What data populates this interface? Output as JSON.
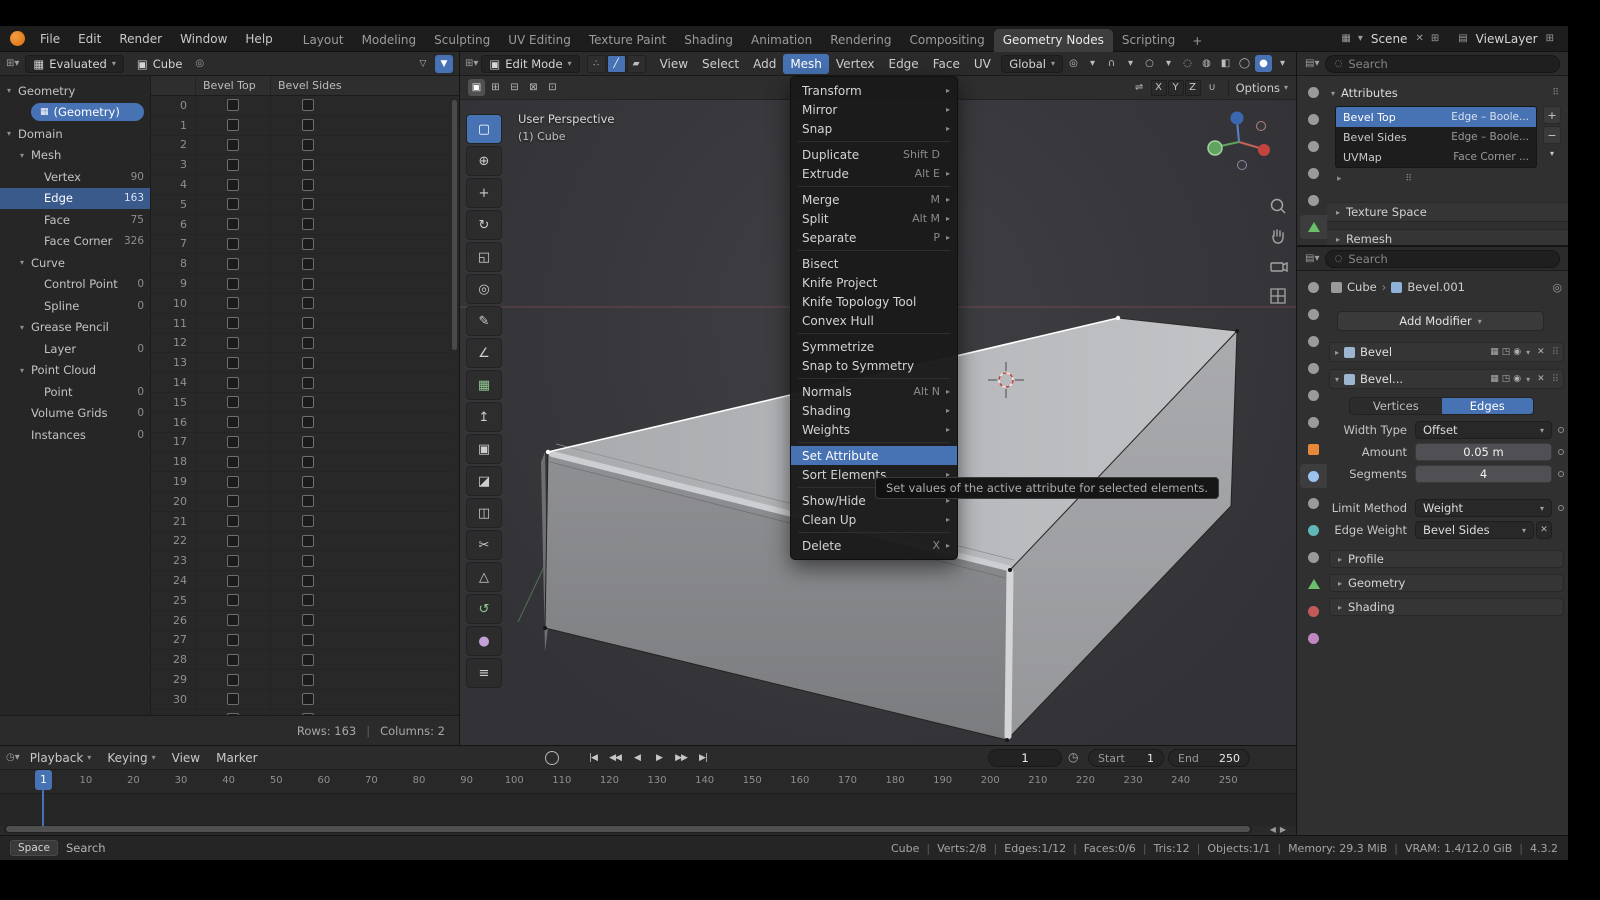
{
  "topbar": {
    "menus": [
      "File",
      "Edit",
      "Render",
      "Window",
      "Help"
    ],
    "workspaces": [
      "Layout",
      "Modeling",
      "Sculpting",
      "UV Editing",
      "Texture Paint",
      "Shading",
      "Animation",
      "Rendering",
      "Compositing",
      "Geometry Nodes",
      "Scripting"
    ],
    "active_workspace": "Geometry Nodes",
    "add_workspace": "+",
    "scene": "Scene",
    "view_layer": "ViewLayer"
  },
  "spreadsheet": {
    "dataset": "Evaluated",
    "object": "Cube",
    "tree": [
      {
        "label": "Geometry",
        "kind": "branch",
        "indent": 0
      },
      {
        "label": "(Geometry)",
        "kind": "pill",
        "indent": 1
      },
      {
        "label": "Domain",
        "kind": "branch",
        "indent": 0
      },
      {
        "label": "Mesh",
        "kind": "branch",
        "indent": 1
      },
      {
        "label": "Vertex",
        "count": "90",
        "kind": "leaf",
        "indent": 2
      },
      {
        "label": "Edge",
        "count": "163",
        "kind": "leaf",
        "indent": 2,
        "active": true
      },
      {
        "label": "Face",
        "count": "75",
        "kind": "leaf",
        "indent": 2
      },
      {
        "label": "Face Corner",
        "count": "326",
        "kind": "leaf",
        "indent": 2
      },
      {
        "label": "Curve",
        "kind": "branch",
        "indent": 1
      },
      {
        "label": "Control Point",
        "count": "0",
        "kind": "leaf",
        "indent": 2
      },
      {
        "label": "Spline",
        "count": "0",
        "kind": "leaf",
        "indent": 2
      },
      {
        "label": "Grease Pencil",
        "kind": "branch",
        "indent": 1
      },
      {
        "label": "Layer",
        "count": "0",
        "kind": "leaf",
        "indent": 2
      },
      {
        "label": "Point Cloud",
        "kind": "branch",
        "indent": 1
      },
      {
        "label": "Point",
        "count": "0",
        "kind": "leaf",
        "indent": 2
      },
      {
        "label": "Volume Grids",
        "count": "0",
        "kind": "leaf",
        "indent": 1
      },
      {
        "label": "Instances",
        "count": "0",
        "kind": "leaf",
        "indent": 1
      }
    ],
    "columns": [
      "Bevel Top",
      "Bevel Sides"
    ],
    "rows_visible_start": 0,
    "rows_visible_count": 32,
    "footer_rows": "Rows: 163",
    "footer_columns": "Columns: 2"
  },
  "viewport": {
    "mode": "Edit Mode",
    "menus": [
      "View",
      "Select",
      "Add",
      "Mesh",
      "Vertex",
      "Edge",
      "Face",
      "UV"
    ],
    "active_menu": "Mesh",
    "orientation": "Global",
    "options_label": "Options",
    "mirror_axes": [
      "X",
      "Y",
      "Z"
    ],
    "overlay_title": "User Perspective",
    "overlay_subtitle": "(1) Cube",
    "select_modes": [
      {
        "name": "vertex-select-mode",
        "glyph": "∴"
      },
      {
        "name": "edge-select-mode",
        "glyph": "╱",
        "active": true
      },
      {
        "name": "face-select-mode",
        "glyph": "▰"
      }
    ],
    "select_options": [
      {
        "name": "select-set",
        "glyph": "▣",
        "active": true
      },
      {
        "name": "select-extend",
        "glyph": "⊞"
      },
      {
        "name": "select-subtract",
        "glyph": "⊟"
      },
      {
        "name": "select-difference",
        "glyph": "⊠"
      },
      {
        "name": "select-intersect",
        "glyph": "⊡"
      }
    ],
    "header_icons": [
      {
        "name": "transform-pivot",
        "glyph": "◎"
      },
      {
        "name": "pivot-dropdown",
        "glyph": "▾"
      },
      {
        "name": "snap-magnet",
        "glyph": "∩"
      },
      {
        "name": "snap-dropdown",
        "glyph": "▾"
      },
      {
        "name": "proportional-editing",
        "glyph": "○"
      },
      {
        "name": "proportional-dropdown",
        "glyph": "▾"
      },
      {
        "name": "show-gizmo",
        "glyph": "◌"
      },
      {
        "name": "show-overlays",
        "glyph": "◍"
      },
      {
        "name": "toggle-xray",
        "glyph": "◧"
      },
      {
        "name": "shading-wireframe",
        "glyph": "◯"
      },
      {
        "name": "shading-solid",
        "glyph": "●",
        "active": true
      },
      {
        "name": "shading-dropdown",
        "glyph": "▾"
      }
    ]
  },
  "toolbar": {
    "tools": [
      {
        "name": "box-select",
        "glyph": "▢",
        "active": true
      },
      {
        "name": "cursor",
        "glyph": "⊕"
      },
      {
        "name": "move",
        "glyph": "+"
      },
      {
        "name": "rotate",
        "glyph": "↻"
      },
      {
        "name": "scale",
        "glyph": "◱"
      },
      {
        "name": "transform",
        "glyph": "◎"
      },
      {
        "name": "annotate",
        "glyph": "✎"
      },
      {
        "name": "measure",
        "glyph": "∠"
      },
      {
        "name": "add-cube",
        "glyph": "▦",
        "tint": "#8fc98f"
      },
      {
        "name": "extrude-region",
        "glyph": "↥"
      },
      {
        "name": "inset-faces",
        "glyph": "▣"
      },
      {
        "name": "bevel",
        "glyph": "◪"
      },
      {
        "name": "loop-cut",
        "glyph": "◫"
      },
      {
        "name": "knife",
        "glyph": "✂"
      },
      {
        "name": "poly-build",
        "glyph": "△"
      },
      {
        "name": "spin",
        "glyph": "↺",
        "tint": "#8fc98f"
      },
      {
        "name": "smooth",
        "glyph": "●",
        "tint": "#c2a0d8"
      },
      {
        "name": "edge-slide",
        "glyph": "≡"
      }
    ]
  },
  "mesh_menu": {
    "groups": [
      [
        {
          "label": "Transform",
          "sub": true
        },
        {
          "label": "Mirror",
          "sub": true
        },
        {
          "label": "Snap",
          "sub": true
        }
      ],
      [
        {
          "label": "Duplicate",
          "key": "Shift D"
        },
        {
          "label": "Extrude",
          "key": "Alt E",
          "sub": true
        }
      ],
      [
        {
          "label": "Merge",
          "key": "M",
          "sub": true
        },
        {
          "label": "Split",
          "key": "Alt M",
          "sub": true
        },
        {
          "label": "Separate",
          "key": "P",
          "sub": true
        }
      ],
      [
        {
          "label": "Bisect"
        },
        {
          "label": "Knife Project"
        },
        {
          "label": "Knife Topology Tool"
        },
        {
          "label": "Convex Hull"
        }
      ],
      [
        {
          "label": "Symmetrize"
        },
        {
          "label": "Snap to Symmetry"
        }
      ],
      [
        {
          "label": "Normals",
          "key": "Alt N",
          "sub": true
        },
        {
          "label": "Shading",
          "sub": true
        },
        {
          "label": "Weights",
          "sub": true
        }
      ],
      [
        {
          "label": "Set Attribute",
          "active": true
        },
        {
          "label": "Sort Elements",
          "sub": true
        }
      ],
      [
        {
          "label": "Show/Hide",
          "sub": true
        },
        {
          "label": "Clean Up",
          "sub": true
        }
      ],
      [
        {
          "label": "Delete",
          "key": "X",
          "sub": true
        }
      ]
    ]
  },
  "tooltip": {
    "text": "Set values of the active attribute for selected elements."
  },
  "prop_tabs_top": [
    {
      "name": "tool"
    },
    {
      "name": "render"
    },
    {
      "name": "output"
    },
    {
      "name": "view-layer"
    },
    {
      "name": "scene"
    },
    {
      "name": "object-data",
      "shape": "triangle",
      "color": "#6cc06c",
      "active": true
    }
  ],
  "prop_tabs_bottom": [
    {
      "name": "tool"
    },
    {
      "name": "render"
    },
    {
      "name": "output"
    },
    {
      "name": "view-layer"
    },
    {
      "name": "scene"
    },
    {
      "name": "world"
    },
    {
      "name": "object",
      "shape": "square",
      "color": "#e8883a"
    },
    {
      "name": "modifiers",
      "color": "#9cc3ee",
      "active": true
    },
    {
      "name": "particles"
    },
    {
      "name": "physics",
      "color": "#5fb7b7"
    },
    {
      "name": "constraints"
    },
    {
      "name": "object-data",
      "shape": "triangle",
      "color": "#6cc06c"
    },
    {
      "name": "material",
      "color": "#c45959"
    },
    {
      "name": "texture",
      "color": "#c187c1"
    }
  ],
  "data_props": {
    "search_placeholder": "Search",
    "attributes_panel": "Attributes",
    "attributes": [
      {
        "name": "Bevel Top",
        "type": "Edge – Boole...",
        "selected": true
      },
      {
        "name": "Bevel Sides",
        "type": "Edge – Boole..."
      },
      {
        "name": "UVMap",
        "type": "Face Corner ..."
      }
    ],
    "add_label": "+",
    "remove_label": "−",
    "specials_label": "▾",
    "texture_space_panel": "Texture Space",
    "remesh_panel": "Remesh"
  },
  "mod_props": {
    "search_placeholder": "Search",
    "breadcrumb_object": "Cube",
    "breadcrumb_modifier": "Bevel.001",
    "add_modifier": "Add Modifier",
    "modifier1_name": "Bevel",
    "modifier2_name": "Bevel...",
    "toggle_icons": [
      {
        "name": "show-in-editmode-toggle",
        "glyph": "▦"
      },
      {
        "name": "show-realtime-toggle",
        "glyph": "◳"
      },
      {
        "name": "show-render-toggle",
        "glyph": "◉"
      }
    ],
    "segmented": [
      "Vertices",
      "Edges"
    ],
    "segmented_active": "Edges",
    "fields": [
      {
        "label": "Width Type",
        "value": "Offset",
        "kind": "menu",
        "dot": true
      },
      {
        "label": "Amount",
        "value": "0.05 m",
        "kind": "number",
        "dot": true
      },
      {
        "label": "Segments",
        "value": "4",
        "kind": "number",
        "dot": true
      },
      {
        "label": "Limit Method",
        "value": "Weight",
        "kind": "menu",
        "dot": true,
        "gap": true
      },
      {
        "label": "Edge Weight",
        "value": "Bevel Sides",
        "kind": "menu-x",
        "dot": false
      }
    ],
    "subpanels": [
      "Profile",
      "Geometry",
      "Shading"
    ]
  },
  "timeline": {
    "menus": [
      "Playback",
      "Keying",
      "View",
      "Marker"
    ],
    "menu_dropdown": [
      true,
      true,
      false,
      false
    ],
    "playback_buttons": [
      {
        "name": "jump-to-start",
        "glyph": "|◀"
      },
      {
        "name": "prev-keyframe",
        "glyph": "◀◀"
      },
      {
        "name": "play-reverse",
        "glyph": "◀"
      },
      {
        "name": "play",
        "glyph": "▶"
      },
      {
        "name": "next-keyframe",
        "glyph": "▶▶"
      },
      {
        "name": "jump-to-end",
        "glyph": "▶|"
      }
    ],
    "current_frame": "1",
    "playhead_frame": "1",
    "start_label": "Start",
    "start_value": "1",
    "end_label": "End",
    "end_value": "250",
    "ticks": [
      10,
      20,
      30,
      40,
      50,
      60,
      70,
      80,
      90,
      100,
      110,
      120,
      130,
      140,
      150,
      160,
      170,
      180,
      190,
      200,
      210,
      220,
      230,
      240,
      250
    ]
  },
  "statusbar": {
    "key": "Space",
    "action": "Search",
    "segments": [
      "Cube",
      "Verts:2/8",
      "Edges:1/12",
      "Faces:0/6",
      "Tris:12",
      "Objects:1/1",
      "Memory: 29.3 MiB",
      "VRAM: 1.4/12.0 GiB",
      "4.3.2"
    ]
  }
}
